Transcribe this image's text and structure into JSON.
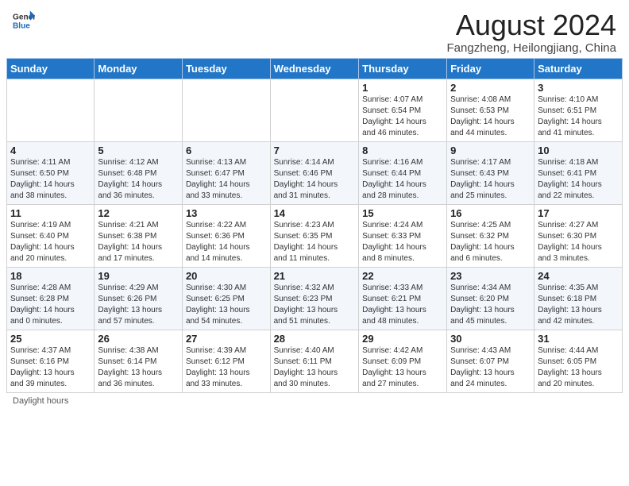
{
  "header": {
    "logo_general": "General",
    "logo_blue": "Blue",
    "month_title": "August 2024",
    "subtitle": "Fangzheng, Heilongjiang, China"
  },
  "weekdays": [
    "Sunday",
    "Monday",
    "Tuesday",
    "Wednesday",
    "Thursday",
    "Friday",
    "Saturday"
  ],
  "weeks": [
    [
      {
        "day": "",
        "info": ""
      },
      {
        "day": "",
        "info": ""
      },
      {
        "day": "",
        "info": ""
      },
      {
        "day": "",
        "info": ""
      },
      {
        "day": "1",
        "info": "Sunrise: 4:07 AM\nSunset: 6:54 PM\nDaylight: 14 hours\nand 46 minutes."
      },
      {
        "day": "2",
        "info": "Sunrise: 4:08 AM\nSunset: 6:53 PM\nDaylight: 14 hours\nand 44 minutes."
      },
      {
        "day": "3",
        "info": "Sunrise: 4:10 AM\nSunset: 6:51 PM\nDaylight: 14 hours\nand 41 minutes."
      }
    ],
    [
      {
        "day": "4",
        "info": "Sunrise: 4:11 AM\nSunset: 6:50 PM\nDaylight: 14 hours\nand 38 minutes."
      },
      {
        "day": "5",
        "info": "Sunrise: 4:12 AM\nSunset: 6:48 PM\nDaylight: 14 hours\nand 36 minutes."
      },
      {
        "day": "6",
        "info": "Sunrise: 4:13 AM\nSunset: 6:47 PM\nDaylight: 14 hours\nand 33 minutes."
      },
      {
        "day": "7",
        "info": "Sunrise: 4:14 AM\nSunset: 6:46 PM\nDaylight: 14 hours\nand 31 minutes."
      },
      {
        "day": "8",
        "info": "Sunrise: 4:16 AM\nSunset: 6:44 PM\nDaylight: 14 hours\nand 28 minutes."
      },
      {
        "day": "9",
        "info": "Sunrise: 4:17 AM\nSunset: 6:43 PM\nDaylight: 14 hours\nand 25 minutes."
      },
      {
        "day": "10",
        "info": "Sunrise: 4:18 AM\nSunset: 6:41 PM\nDaylight: 14 hours\nand 22 minutes."
      }
    ],
    [
      {
        "day": "11",
        "info": "Sunrise: 4:19 AM\nSunset: 6:40 PM\nDaylight: 14 hours\nand 20 minutes."
      },
      {
        "day": "12",
        "info": "Sunrise: 4:21 AM\nSunset: 6:38 PM\nDaylight: 14 hours\nand 17 minutes."
      },
      {
        "day": "13",
        "info": "Sunrise: 4:22 AM\nSunset: 6:36 PM\nDaylight: 14 hours\nand 14 minutes."
      },
      {
        "day": "14",
        "info": "Sunrise: 4:23 AM\nSunset: 6:35 PM\nDaylight: 14 hours\nand 11 minutes."
      },
      {
        "day": "15",
        "info": "Sunrise: 4:24 AM\nSunset: 6:33 PM\nDaylight: 14 hours\nand 8 minutes."
      },
      {
        "day": "16",
        "info": "Sunrise: 4:25 AM\nSunset: 6:32 PM\nDaylight: 14 hours\nand 6 minutes."
      },
      {
        "day": "17",
        "info": "Sunrise: 4:27 AM\nSunset: 6:30 PM\nDaylight: 14 hours\nand 3 minutes."
      }
    ],
    [
      {
        "day": "18",
        "info": "Sunrise: 4:28 AM\nSunset: 6:28 PM\nDaylight: 14 hours\nand 0 minutes."
      },
      {
        "day": "19",
        "info": "Sunrise: 4:29 AM\nSunset: 6:26 PM\nDaylight: 13 hours\nand 57 minutes."
      },
      {
        "day": "20",
        "info": "Sunrise: 4:30 AM\nSunset: 6:25 PM\nDaylight: 13 hours\nand 54 minutes."
      },
      {
        "day": "21",
        "info": "Sunrise: 4:32 AM\nSunset: 6:23 PM\nDaylight: 13 hours\nand 51 minutes."
      },
      {
        "day": "22",
        "info": "Sunrise: 4:33 AM\nSunset: 6:21 PM\nDaylight: 13 hours\nand 48 minutes."
      },
      {
        "day": "23",
        "info": "Sunrise: 4:34 AM\nSunset: 6:20 PM\nDaylight: 13 hours\nand 45 minutes."
      },
      {
        "day": "24",
        "info": "Sunrise: 4:35 AM\nSunset: 6:18 PM\nDaylight: 13 hours\nand 42 minutes."
      }
    ],
    [
      {
        "day": "25",
        "info": "Sunrise: 4:37 AM\nSunset: 6:16 PM\nDaylight: 13 hours\nand 39 minutes."
      },
      {
        "day": "26",
        "info": "Sunrise: 4:38 AM\nSunset: 6:14 PM\nDaylight: 13 hours\nand 36 minutes."
      },
      {
        "day": "27",
        "info": "Sunrise: 4:39 AM\nSunset: 6:12 PM\nDaylight: 13 hours\nand 33 minutes."
      },
      {
        "day": "28",
        "info": "Sunrise: 4:40 AM\nSunset: 6:11 PM\nDaylight: 13 hours\nand 30 minutes."
      },
      {
        "day": "29",
        "info": "Sunrise: 4:42 AM\nSunset: 6:09 PM\nDaylight: 13 hours\nand 27 minutes."
      },
      {
        "day": "30",
        "info": "Sunrise: 4:43 AM\nSunset: 6:07 PM\nDaylight: 13 hours\nand 24 minutes."
      },
      {
        "day": "31",
        "info": "Sunrise: 4:44 AM\nSunset: 6:05 PM\nDaylight: 13 hours\nand 20 minutes."
      }
    ]
  ],
  "footer": {
    "daylight_label": "Daylight hours"
  }
}
